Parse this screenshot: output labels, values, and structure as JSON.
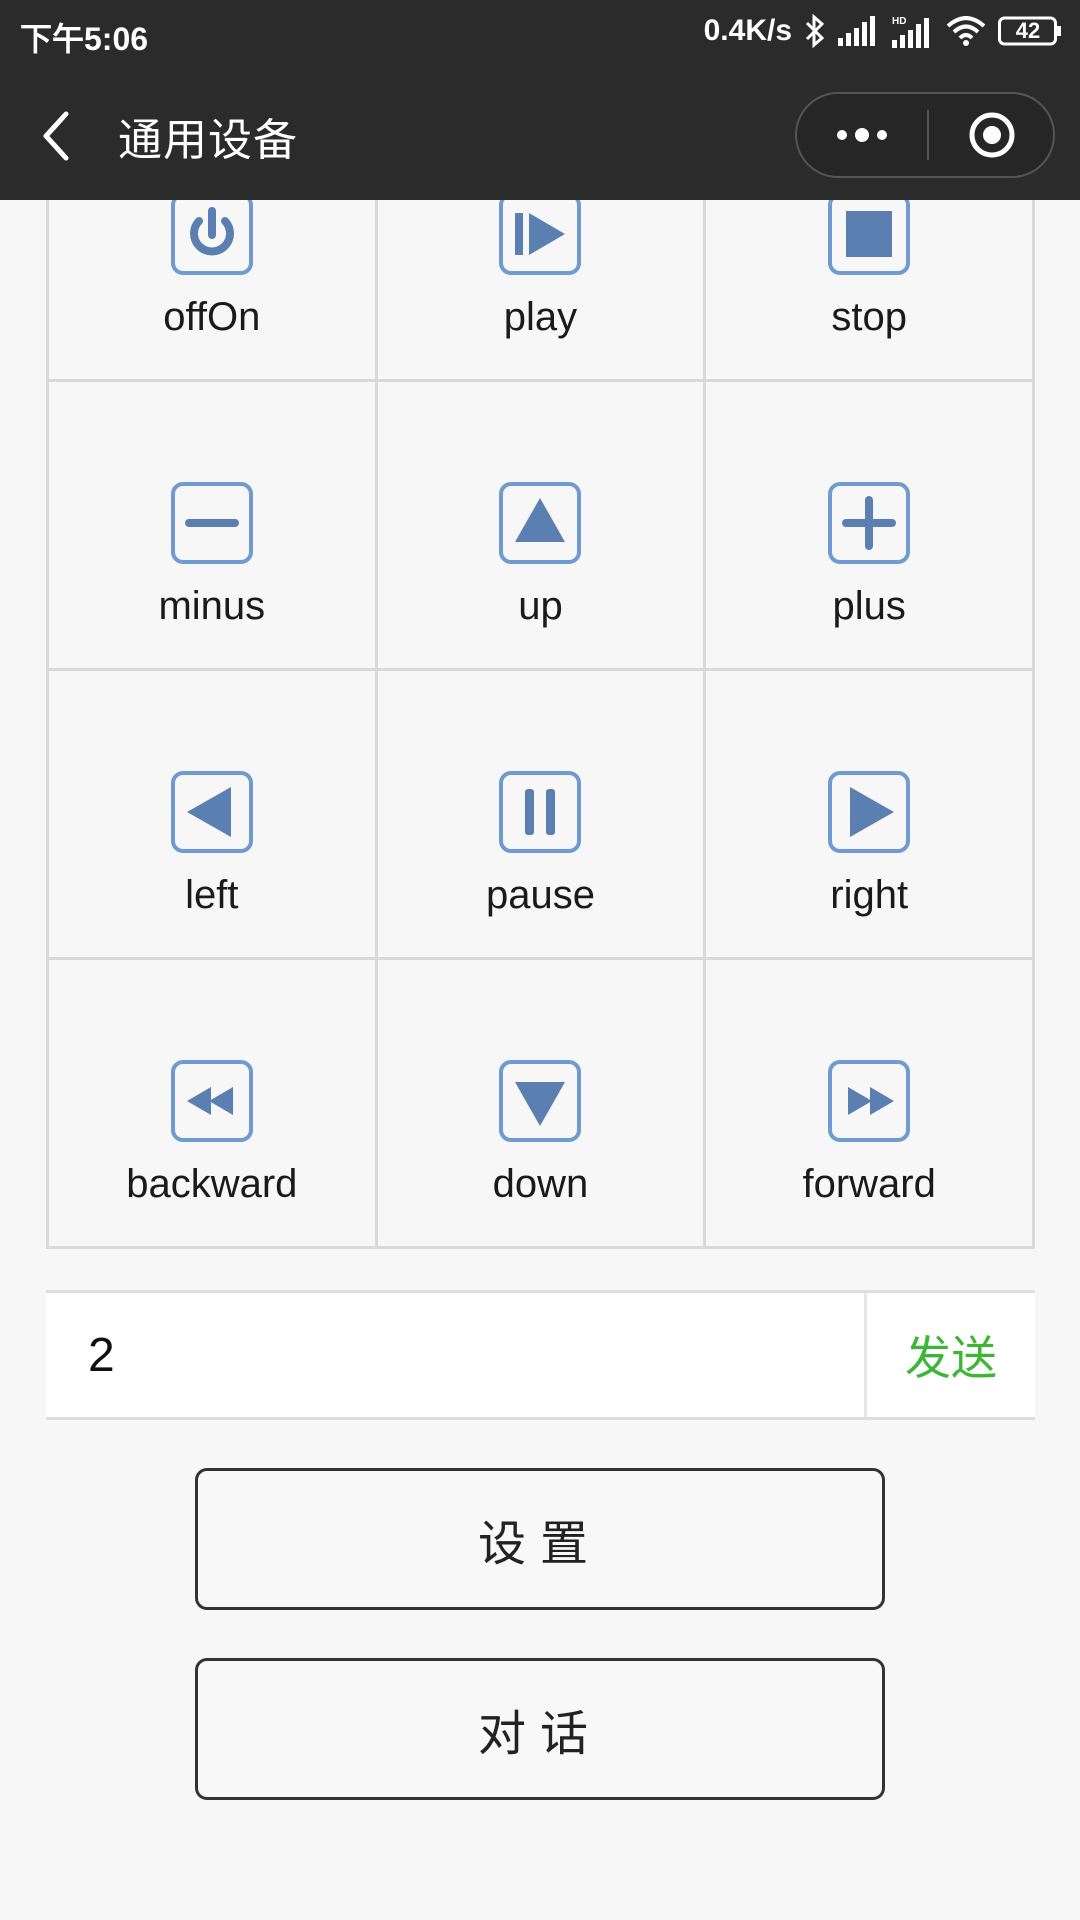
{
  "status_bar": {
    "time": "下午5:06",
    "net_speed": "0.4K/s",
    "battery": "42"
  },
  "nav": {
    "title": "通用设备"
  },
  "colors": {
    "icon_stroke": "#6f9bd0",
    "icon_fill": "#5b7fb0",
    "send_green": "#3cb634",
    "header_bg": "#2b2b2b"
  },
  "grid": {
    "cells": [
      {
        "label": "offOn",
        "icon": "power-icon"
      },
      {
        "label": "play",
        "icon": "play-icon"
      },
      {
        "label": "stop",
        "icon": "stop-icon"
      },
      {
        "label": "minus",
        "icon": "minus-icon"
      },
      {
        "label": "up",
        "icon": "up-arrow-icon"
      },
      {
        "label": "plus",
        "icon": "plus-icon"
      },
      {
        "label": "left",
        "icon": "left-arrow-icon"
      },
      {
        "label": "pause",
        "icon": "pause-icon"
      },
      {
        "label": "right",
        "icon": "right-arrow-icon"
      },
      {
        "label": "backward",
        "icon": "rewind-icon"
      },
      {
        "label": "down",
        "icon": "down-arrow-icon"
      },
      {
        "label": "forward",
        "icon": "fast-forward-icon"
      }
    ]
  },
  "send": {
    "input_value": "2",
    "button_label": "发送"
  },
  "buttons": {
    "settings": "设置",
    "dialog": "对话"
  }
}
